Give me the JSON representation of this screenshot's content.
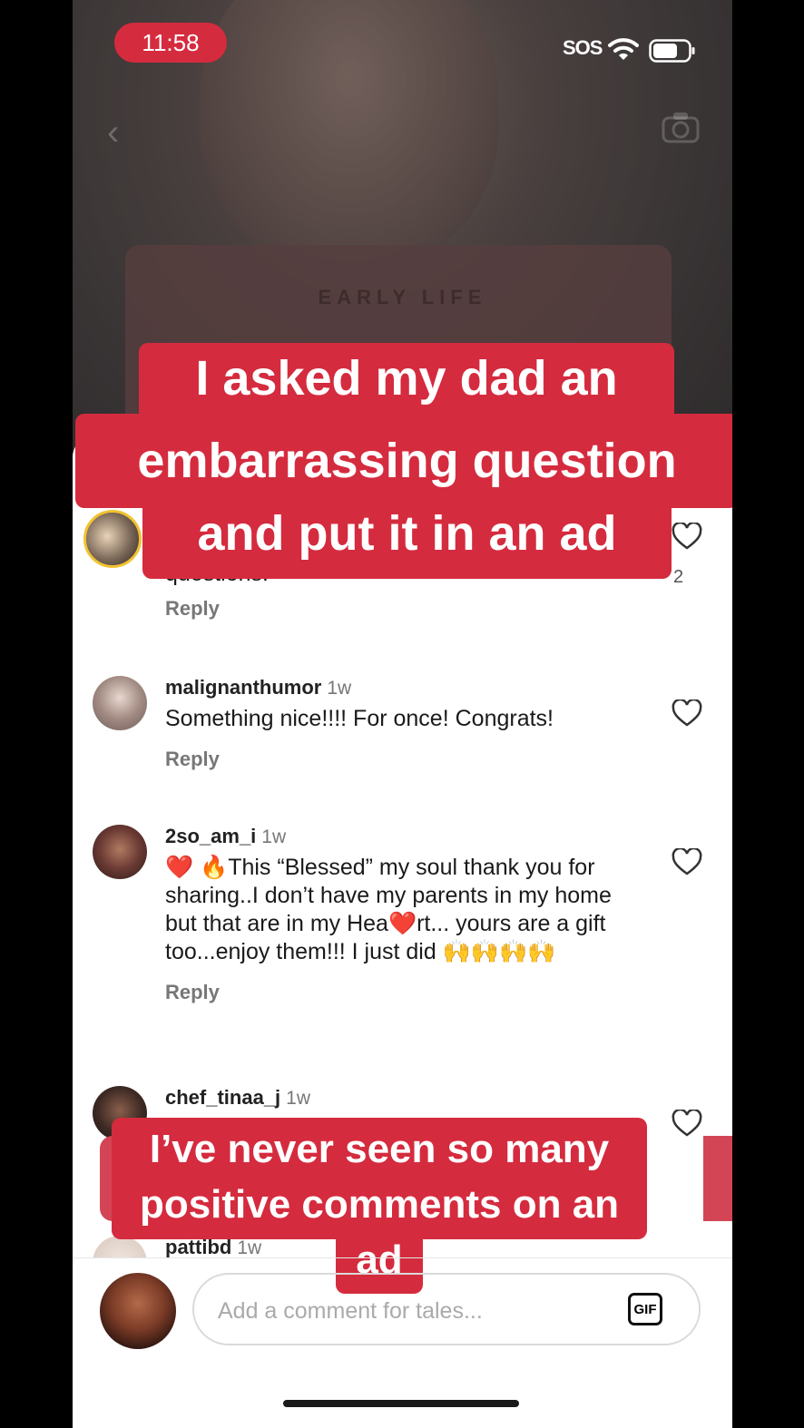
{
  "status_bar": {
    "time": "11:58",
    "sos": "SOS"
  },
  "video": {
    "card_text": "EARLY LIFE"
  },
  "captions": {
    "top": [
      "I asked my dad an",
      "embarrassing question",
      "and put it in an ad"
    ],
    "bottom": [
      "I’ve never seen so many",
      "positive comments on an",
      "ad"
    ]
  },
  "comments": [
    {
      "username": "",
      "time": "",
      "text": "questions!",
      "reply": "Reply",
      "likes": "2"
    },
    {
      "username": "malignanthumor",
      "time": "1w",
      "text": "Something nice!!!! For once! Congrats!",
      "reply": "Reply"
    },
    {
      "username": "2so_am_i",
      "time": "1w",
      "text": "❤️ 🔥This “Blessed” my soul thank you for sharing..I don’t have my parents  in my home but that are in my Hea❤️rt... yours are a gift too...enjoy them!!! I just did 🙌🙌🙌🙌",
      "reply": "Reply"
    },
    {
      "username": "chef_tinaa_j",
      "time": "1w",
      "text": "",
      "reply": ""
    },
    {
      "username": "pattibd",
      "time": "1w",
      "text": "",
      "reply": ""
    }
  ],
  "input": {
    "placeholder": "Add a comment for tales...",
    "gif_label": "GIF"
  },
  "next_label": "›",
  "colors": {
    "accent": "#d52b3e",
    "background": "#ffffff"
  }
}
